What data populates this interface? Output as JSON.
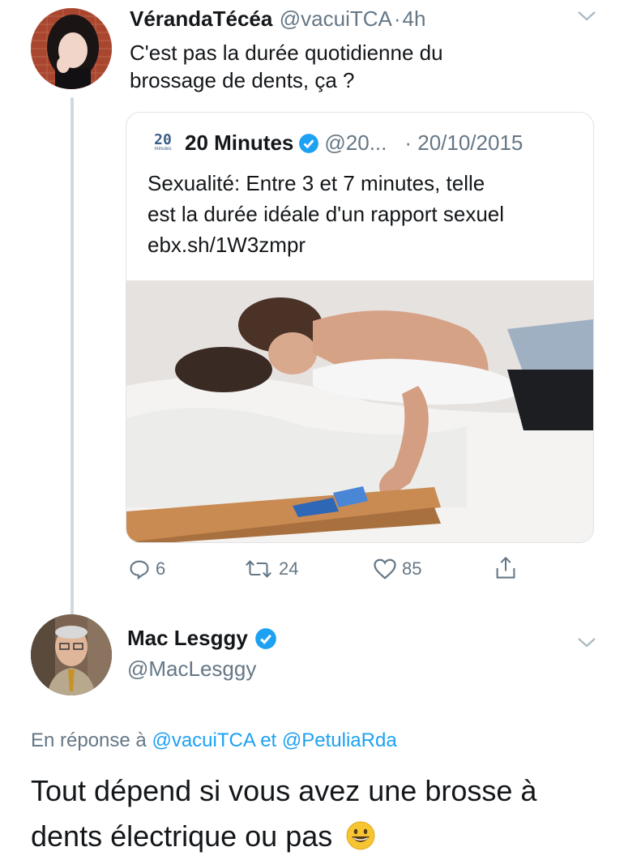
{
  "tweet1": {
    "display_name": "VérandaTécéa",
    "handle": "@vacuiTCA",
    "separator": "·",
    "time": "4h",
    "text_line1": "C'est pas la durée quotidienne du",
    "text_line2": "brossage de dents, ça ?",
    "avatar_icon": "profile-photo-woman",
    "menu_icon": "chevron-down-icon"
  },
  "quoted": {
    "logo_text": "20",
    "logo_subtext": "minutes",
    "display_name": "20 Minutes",
    "handle": "@20...",
    "date": "· 20/10/2015",
    "text_line1": "Sexualité: Entre 3 et 7 minutes, telle",
    "text_line2": "est la durée idéale d'un rapport sexuel",
    "text_line3": "ebx.sh/1W3zmpr",
    "verified_icon": "verified-badge-icon"
  },
  "actions": {
    "replies": "6",
    "retweets": "24",
    "likes": "85",
    "share_icon": "share-icon"
  },
  "tweet2": {
    "display_name": "Mac Lesggy",
    "handle": "@MacLesggy",
    "reply_prefix": "En réponse à",
    "mention1": "@vacuiTCA",
    "conj": "et",
    "mention2": "@PetuliaRda",
    "text_line1": "Tout dépend si vous avez une brosse à",
    "text_line2": "dents électrique ou pas",
    "emoji": "😀",
    "avatar_icon": "profile-photo-man"
  },
  "colors": {
    "link_blue": "#1da1f2",
    "secondary_gray": "#657786",
    "verified_blue": "#1da1f2"
  }
}
